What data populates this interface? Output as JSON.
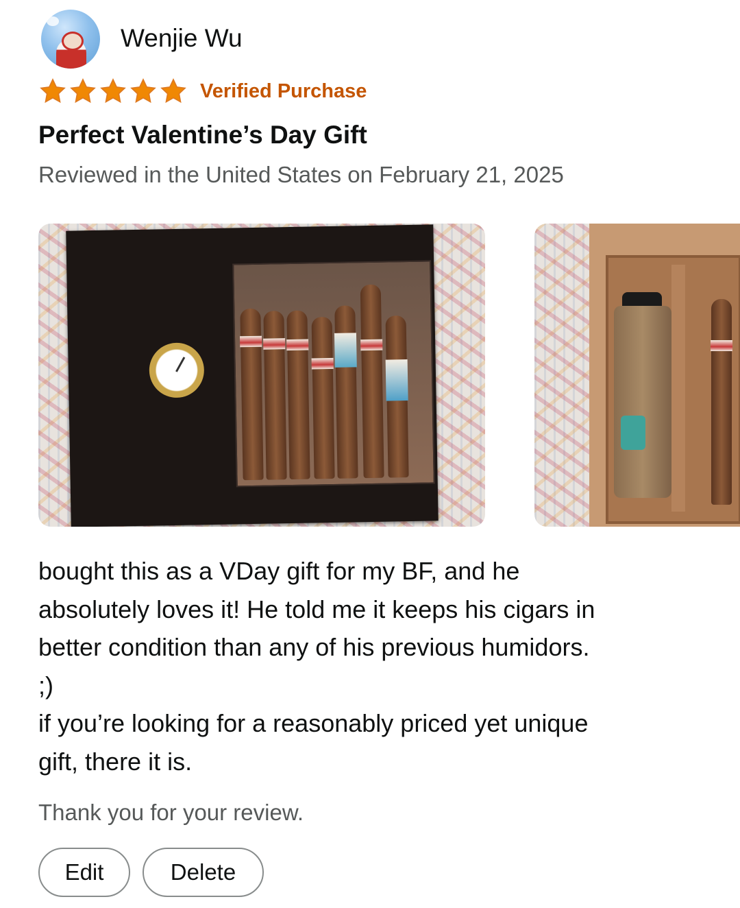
{
  "review": {
    "reviewer_name": "Wenjie Wu",
    "avatar_icon": "user-avatar-photo",
    "rating": 5,
    "rating_max": 5,
    "star_color": "#f08804",
    "verified_label": "Verified Purchase",
    "verified_color": "#c45500",
    "title": "Perfect Valentine’s Day Gift",
    "meta": "Reviewed in the United States on February 21, 2025",
    "images": [
      {
        "icon": "humidor-top-view-photo"
      },
      {
        "icon": "humidor-open-interior-photo"
      }
    ],
    "body": "bought this as a VDay gift for my BF, and he\nabsolutely loves it! He told me it keeps his cigars in\nbetter condition than any of his previous humidors.\n;)\nif you’re looking for a reasonably priced yet unique\ngift, there it is.",
    "thanks": "Thank you for your review.",
    "actions": {
      "edit_label": "Edit",
      "delete_label": "Delete"
    }
  }
}
